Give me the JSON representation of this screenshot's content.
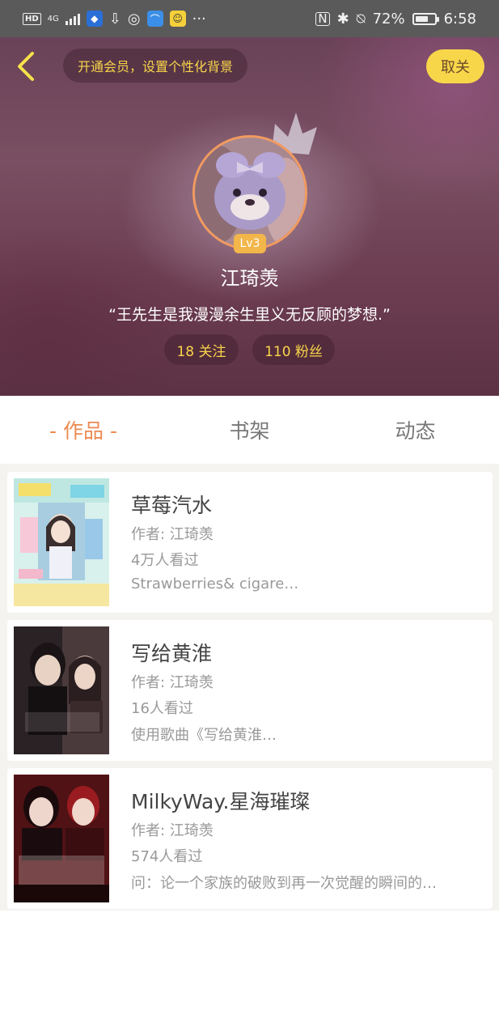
{
  "status_bar": {
    "hd": "HD",
    "network": "4G",
    "battery": "72%",
    "time": "6:58"
  },
  "header": {
    "vip_prompt": "开通会员，设置个性化背景",
    "unfollow_label": "取关"
  },
  "profile": {
    "level": "Lv3",
    "name": "江琦羡",
    "bio": "“王先生是我漫漫余生里义无反顾的梦想.”",
    "following": "18 关注",
    "fans": "110 粉丝"
  },
  "tabs": [
    {
      "label": "- 作品 -",
      "active": true
    },
    {
      "label": "书架",
      "active": false
    },
    {
      "label": "动态",
      "active": false
    }
  ],
  "works": [
    {
      "title": "草莓汽水",
      "author": "作者: 江琦羡",
      "views": "4万人看过",
      "desc": "Strawberries& cigare…"
    },
    {
      "title": "写给黄淮",
      "author": "作者: 江琦羡",
      "views": "16人看过",
      "desc": "使用歌曲《写给黄淮…"
    },
    {
      "title": "MilkyWay.星海璀璨",
      "author": "作者: 江琦羡",
      "views": "574人看过",
      "desc": "问：论一个家族的破败到再一次觉醒的瞬间的…"
    }
  ],
  "colors": {
    "accent_orange": "#ec8a52",
    "yellow": "#f8d64a",
    "status_bar": "#5a5a5a"
  }
}
